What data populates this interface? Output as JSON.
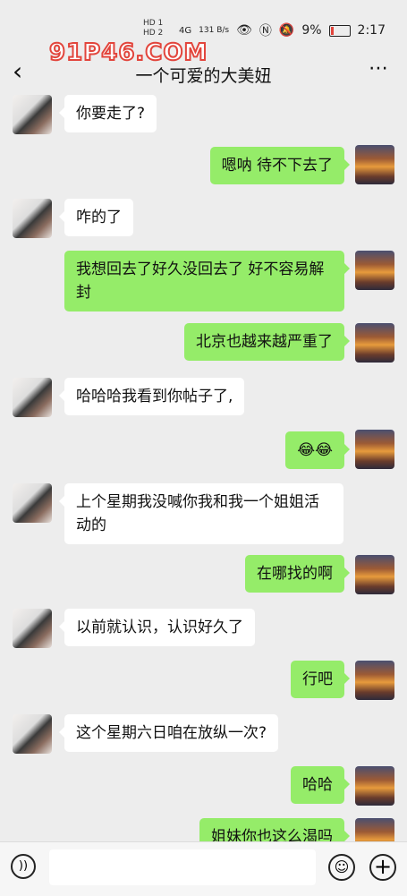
{
  "status": {
    "hd1": "HD 1",
    "hd2": "HD 2",
    "signal": "4G",
    "speed": "131 B/s",
    "battery": "9%",
    "time": "2:17"
  },
  "watermark": "91P46.COM",
  "nav": {
    "back_icon": "chevron-left-icon",
    "title": "一个可爱的大美妞",
    "more_icon": "more-icon"
  },
  "messages": [
    {
      "side": "left",
      "text": "你要走了?"
    },
    {
      "side": "right",
      "text": "嗯呐 待不下去了"
    },
    {
      "side": "left",
      "text": "咋的了"
    },
    {
      "side": "right",
      "text": "我想回去了好久没回去了 好不容易解封"
    },
    {
      "side": "right",
      "text": "北京也越来越严重了"
    },
    {
      "side": "left",
      "text": "哈哈哈我看到你帖子了,"
    },
    {
      "side": "right",
      "text": "😂😂"
    },
    {
      "side": "left",
      "text": "上个星期我没喊你我和我一个姐姐活动的"
    },
    {
      "side": "right",
      "text": "在哪找的啊"
    },
    {
      "side": "left",
      "text": "以前就认识，认识好久了"
    },
    {
      "side": "right",
      "text": "行吧"
    },
    {
      "side": "left",
      "text": "这个星期六日咱在放纵一次?"
    },
    {
      "side": "right",
      "text": "哈哈"
    },
    {
      "side": "right",
      "text": "姐妹你也这么渴吗"
    }
  ],
  "inputbar": {
    "voice_icon": "voice-icon",
    "emoji_icon": "emoji-icon",
    "plus_icon": "plus-icon"
  }
}
